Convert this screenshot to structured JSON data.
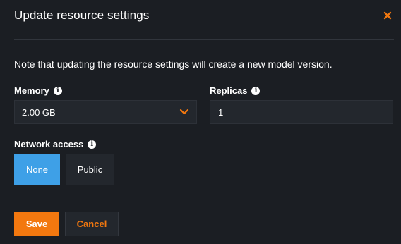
{
  "dialog": {
    "title": "Update resource settings",
    "note": "Note that updating the resource settings will create a new model version."
  },
  "memory": {
    "label": "Memory",
    "value": "2.00 GB"
  },
  "replicas": {
    "label": "Replicas",
    "value": "1"
  },
  "network": {
    "label": "Network access",
    "options": [
      "None",
      "Public"
    ],
    "selected": "None"
  },
  "actions": {
    "save_label": "Save",
    "cancel_label": "Cancel"
  },
  "colors": {
    "accent": "#f3780f",
    "selected": "#3ea0e7",
    "background": "#1b1e23"
  },
  "icons": {
    "close": "close-icon",
    "info": "info-icon",
    "chevron": "chevron-down-icon"
  }
}
